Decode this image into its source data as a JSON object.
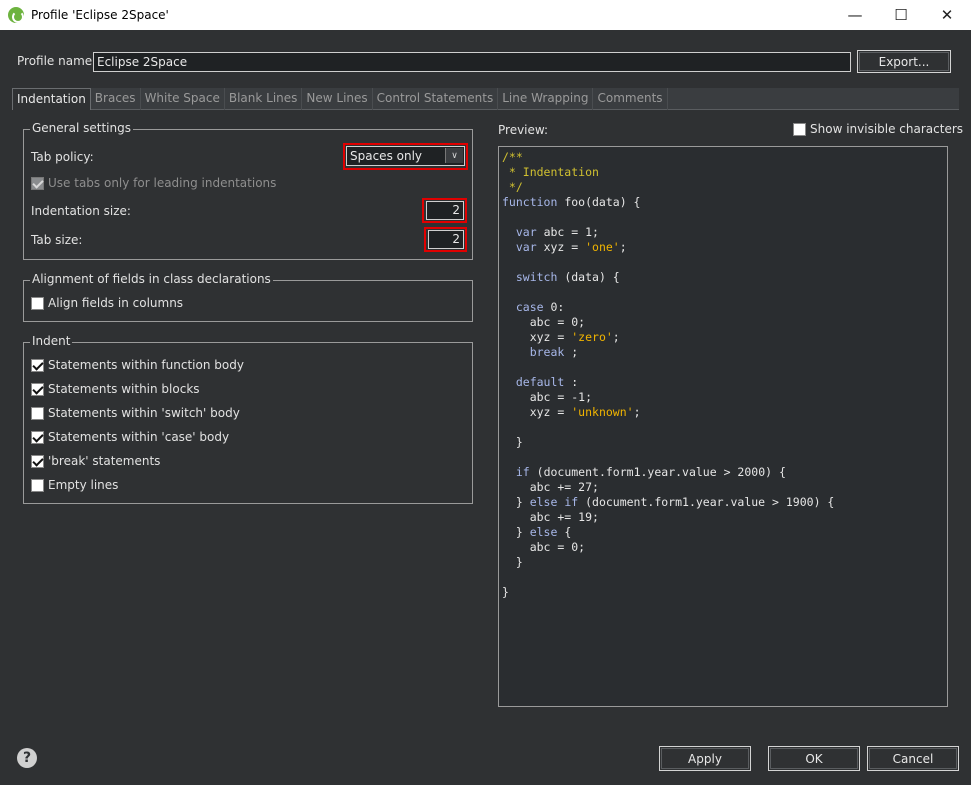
{
  "window": {
    "title": "Profile 'Eclipse 2Space'",
    "minimize_glyph": "—",
    "maximize_glyph": "☐",
    "close_glyph": "✕"
  },
  "profile": {
    "name_label": "Profile name:",
    "name_value": "Eclipse 2Space",
    "export_label": "Export..."
  },
  "tabs": [
    {
      "label": "Indentation",
      "active": true
    },
    {
      "label": "Braces"
    },
    {
      "label": "White Space"
    },
    {
      "label": "Blank Lines"
    },
    {
      "label": "New Lines"
    },
    {
      "label": "Control Statements"
    },
    {
      "label": "Line Wrapping"
    },
    {
      "label": "Comments"
    }
  ],
  "general": {
    "title": "General settings",
    "tab_policy_label": "Tab policy:",
    "tab_policy_value": "Spaces only",
    "use_tabs_leading_label": "Use tabs only for leading indentations",
    "use_tabs_leading_checked": true,
    "indentation_size_label": "Indentation size:",
    "indentation_size_value": "2",
    "tab_size_label": "Tab size:",
    "tab_size_value": "2"
  },
  "alignment": {
    "title": "Alignment of fields in class declarations",
    "align_fields_label": "Align fields in columns",
    "align_fields_checked": false
  },
  "indent": {
    "title": "Indent",
    "items": [
      {
        "label": "Statements within function body",
        "checked": true
      },
      {
        "label": "Statements within blocks",
        "checked": true
      },
      {
        "label": "Statements within 'switch' body",
        "checked": false
      },
      {
        "label": "Statements within 'case' body",
        "checked": true
      },
      {
        "label": "'break' statements",
        "checked": true
      },
      {
        "label": "Empty lines",
        "checked": false
      }
    ]
  },
  "preview": {
    "label": "Preview:",
    "show_invisible_label": "Show invisible characters",
    "show_invisible_checked": false,
    "code_lines": [
      [
        [
          "cm",
          "/**"
        ]
      ],
      [
        [
          "cm",
          " * Indentation"
        ]
      ],
      [
        [
          "cm",
          " */"
        ]
      ],
      [
        [
          "kw",
          "function"
        ],
        [
          "",
          "foo(data) {"
        ]
      ],
      [
        [
          "",
          ""
        ]
      ],
      [
        [
          "",
          "  "
        ],
        [
          "kw",
          "var"
        ],
        [
          "",
          "abc = 1;"
        ]
      ],
      [
        [
          "",
          "  "
        ],
        [
          "kw",
          "var"
        ],
        [
          "",
          "xyz = "
        ],
        [
          "str",
          "'one'"
        ],
        [
          "",
          ";"
        ]
      ],
      [
        [
          "",
          ""
        ]
      ],
      [
        [
          "",
          "  "
        ],
        [
          "kw",
          "switch"
        ],
        [
          "",
          "(data) {"
        ]
      ],
      [
        [
          "",
          ""
        ]
      ],
      [
        [
          "",
          "  "
        ],
        [
          "kw",
          "case"
        ],
        [
          "",
          "0:"
        ]
      ],
      [
        [
          "",
          "    abc = 0;"
        ]
      ],
      [
        [
          "",
          "    xyz = "
        ],
        [
          "str",
          "'zero'"
        ],
        [
          "",
          ";"
        ]
      ],
      [
        [
          "",
          "    "
        ],
        [
          "kw",
          "break"
        ],
        [
          "",
          ";"
        ]
      ],
      [
        [
          "",
          ""
        ]
      ],
      [
        [
          "",
          "  "
        ],
        [
          "kw",
          "default"
        ],
        [
          "",
          ":"
        ]
      ],
      [
        [
          "",
          "    abc = -1;"
        ]
      ],
      [
        [
          "",
          "    xyz = "
        ],
        [
          "str",
          "'unknown'"
        ],
        [
          "",
          ";"
        ]
      ],
      [
        [
          "",
          ""
        ]
      ],
      [
        [
          "",
          "  }"
        ]
      ],
      [
        [
          "",
          ""
        ]
      ],
      [
        [
          "",
          "  "
        ],
        [
          "kw",
          "if"
        ],
        [
          "",
          "(document.form1.year.value > 2000) {"
        ]
      ],
      [
        [
          "",
          "    abc += 27;"
        ]
      ],
      [
        [
          "",
          "  } "
        ],
        [
          "kw",
          "else if"
        ],
        [
          "",
          "(document.form1.year.value > 1900) {"
        ]
      ],
      [
        [
          "",
          "    abc += 19;"
        ]
      ],
      [
        [
          "",
          "  } "
        ],
        [
          "kw",
          "else"
        ],
        [
          "",
          "{"
        ]
      ],
      [
        [
          "",
          "    abc = 0;"
        ]
      ],
      [
        [
          "",
          "  }"
        ]
      ],
      [
        [
          "",
          ""
        ]
      ],
      [
        [
          "",
          "}"
        ]
      ]
    ]
  },
  "footer": {
    "help_glyph": "?",
    "apply_label": "Apply",
    "ok_label": "OK",
    "cancel_label": "Cancel"
  },
  "colors": {
    "background": "#2f3133",
    "highlight": "#e00000",
    "comment": "#d0c030",
    "keyword": "#a7b7e9",
    "string": "#f0b400"
  }
}
